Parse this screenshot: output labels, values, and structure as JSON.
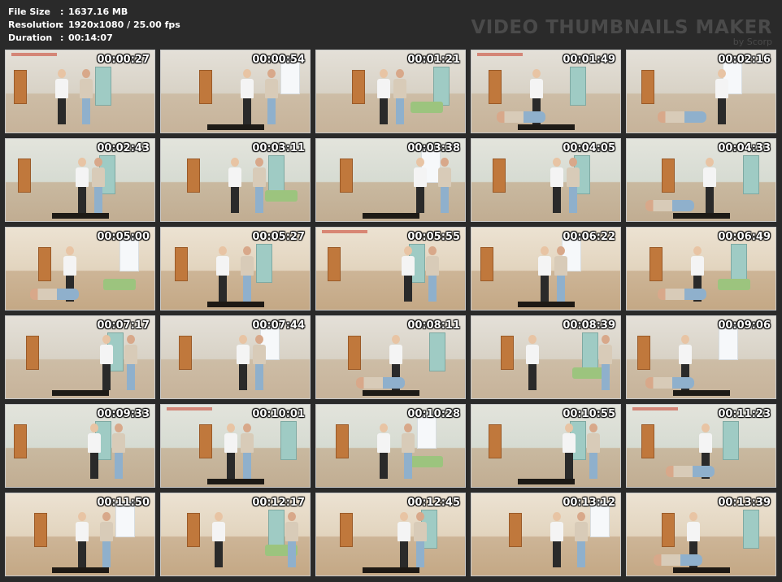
{
  "info": {
    "file_size_label": "File Size",
    "file_size_value": "1637.16 MB",
    "resolution_label": "Resolution",
    "resolution_value": "1920x1080 / 25.00 fps",
    "duration_label": "Duration",
    "duration_value": "00:14:07",
    "colon": ":"
  },
  "brand": {
    "title": "VIDEO THUMBNAILS MAKER",
    "subtitle": "by Scorp"
  },
  "thumbnails": [
    {
      "time": "00:00:27"
    },
    {
      "time": "00:00:54"
    },
    {
      "time": "00:01:21"
    },
    {
      "time": "00:01:49"
    },
    {
      "time": "00:02:16"
    },
    {
      "time": "00:02:43"
    },
    {
      "time": "00:03:11"
    },
    {
      "time": "00:03:38"
    },
    {
      "time": "00:04:05"
    },
    {
      "time": "00:04:33"
    },
    {
      "time": "00:05:00"
    },
    {
      "time": "00:05:27"
    },
    {
      "time": "00:05:55"
    },
    {
      "time": "00:06:22"
    },
    {
      "time": "00:06:49"
    },
    {
      "time": "00:07:17"
    },
    {
      "time": "00:07:44"
    },
    {
      "time": "00:08:11"
    },
    {
      "time": "00:08:39"
    },
    {
      "time": "00:09:06"
    },
    {
      "time": "00:09:33"
    },
    {
      "time": "00:10:01"
    },
    {
      "time": "00:10:28"
    },
    {
      "time": "00:10:55"
    },
    {
      "time": "00:11:23"
    },
    {
      "time": "00:11:50"
    },
    {
      "time": "00:12:17"
    },
    {
      "time": "00:12:45"
    },
    {
      "time": "00:13:12"
    },
    {
      "time": "00:13:39"
    }
  ],
  "colors": {
    "background": "#2a2a2a",
    "text": "#ffffff",
    "brand": "#4a4a4a"
  }
}
